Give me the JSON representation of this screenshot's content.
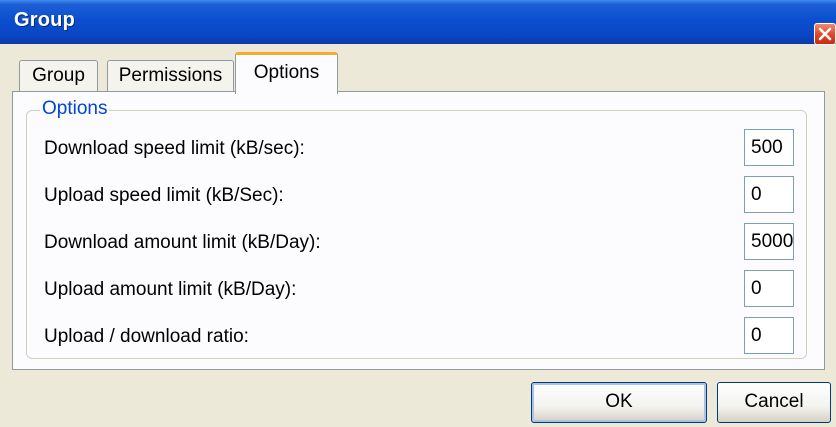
{
  "window": {
    "title": "Group"
  },
  "tabs": [
    {
      "label": "Group",
      "selected": false
    },
    {
      "label": "Permissions",
      "selected": false
    },
    {
      "label": "Options",
      "selected": true
    }
  ],
  "options_group": {
    "legend": "Options",
    "fields": [
      {
        "label": "Download speed limit (kB/sec):",
        "value": "500"
      },
      {
        "label": "Upload speed limit (kB/Sec):",
        "value": "0"
      },
      {
        "label": "Download amount limit (kB/Day):",
        "value": "5000"
      },
      {
        "label": "Upload amount limit (kB/Day):",
        "value": "0"
      },
      {
        "label": "Upload / download ratio:",
        "value": "0"
      }
    ]
  },
  "buttons": {
    "ok_label": "OK",
    "cancel_label": "Cancel"
  },
  "colors": {
    "title_bar": "#0a4fd0",
    "close_button": "#e2492c",
    "selected_tab_accent": "#f8a92f",
    "groupbox_legend": "#0046d5",
    "dialog_background": "#ece9d8"
  },
  "icons": {
    "close": "close-icon"
  }
}
